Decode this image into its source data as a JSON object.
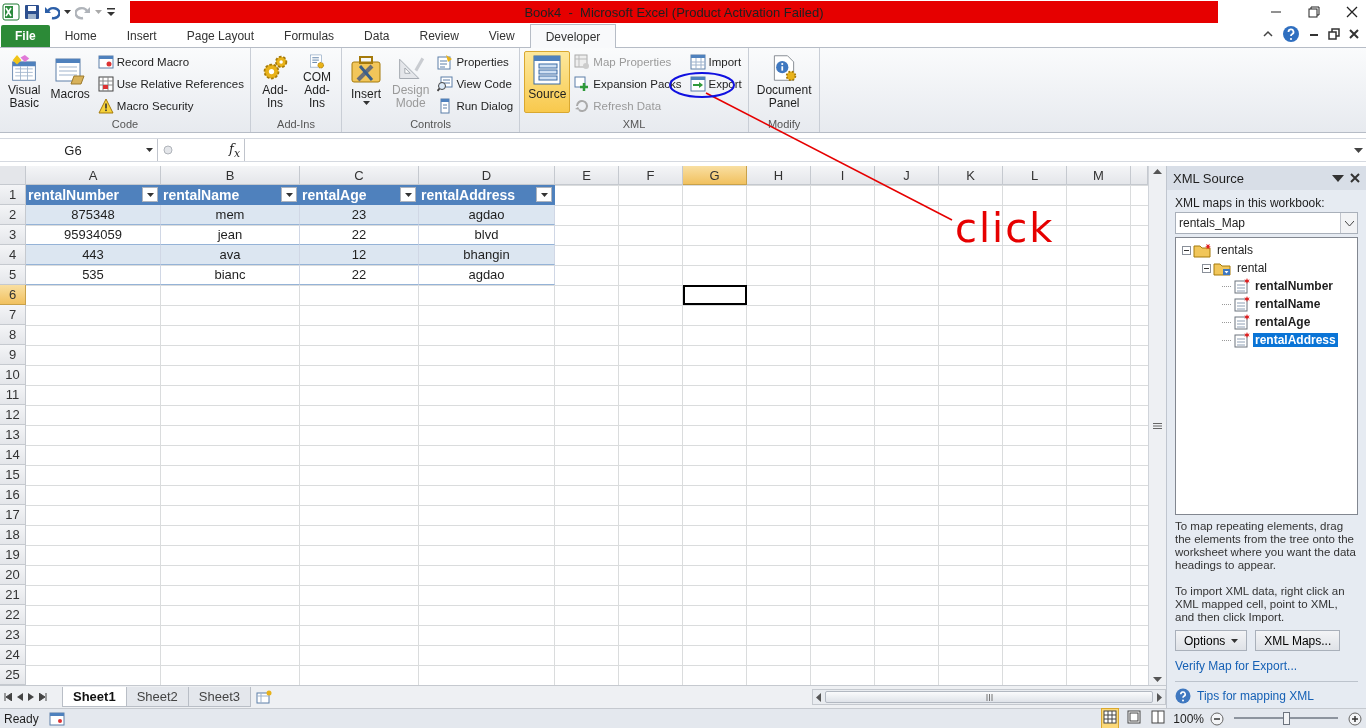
{
  "window": {
    "title": "Book4  -  Microsoft Excel (Product Activation Failed)"
  },
  "ribbon_tabs": [
    {
      "label": "File",
      "kind": "file",
      "selected": false
    },
    {
      "label": "Home",
      "kind": "tab",
      "selected": false
    },
    {
      "label": "Insert",
      "kind": "tab",
      "selected": false
    },
    {
      "label": "Page Layout",
      "kind": "tab",
      "selected": false
    },
    {
      "label": "Formulas",
      "kind": "tab",
      "selected": false
    },
    {
      "label": "Data",
      "kind": "tab",
      "selected": false
    },
    {
      "label": "Review",
      "kind": "tab",
      "selected": false
    },
    {
      "label": "View",
      "kind": "tab",
      "selected": false
    },
    {
      "label": "Developer",
      "kind": "tab",
      "selected": true
    }
  ],
  "ribbon_groups": [
    {
      "label": "Code",
      "items": [
        {
          "label": "Visual Basic",
          "kind": "large",
          "disabled": false,
          "selected": false,
          "dropdown": false
        },
        {
          "label": "Macros",
          "kind": "large",
          "disabled": false,
          "selected": false,
          "dropdown": false
        },
        {
          "label": "Record Macro",
          "kind": "small",
          "disabled": false,
          "selected": false
        },
        {
          "label": "Use Relative References",
          "kind": "small",
          "disabled": false,
          "selected": false
        },
        {
          "label": "Macro Security",
          "kind": "small",
          "disabled": false,
          "selected": false
        }
      ]
    },
    {
      "label": "Add-Ins",
      "items": [
        {
          "label": "Add-Ins",
          "kind": "large",
          "disabled": false,
          "selected": false,
          "dropdown": false
        },
        {
          "label": "COM Add-Ins",
          "kind": "large",
          "disabled": false,
          "selected": false,
          "dropdown": false
        }
      ]
    },
    {
      "label": "Controls",
      "items": [
        {
          "label": "Insert",
          "kind": "large",
          "disabled": false,
          "selected": false,
          "dropdown": true
        },
        {
          "label": "Design Mode",
          "kind": "large",
          "disabled": true,
          "selected": false,
          "dropdown": false
        },
        {
          "label": "Properties",
          "kind": "small",
          "disabled": false,
          "selected": false
        },
        {
          "label": "View Code",
          "kind": "small",
          "disabled": false,
          "selected": false
        },
        {
          "label": "Run Dialog",
          "kind": "small",
          "disabled": false,
          "selected": false
        }
      ]
    },
    {
      "label": "XML",
      "items": [
        {
          "label": "Source",
          "kind": "large",
          "disabled": false,
          "selected": true,
          "dropdown": false
        },
        {
          "label": "Map Properties",
          "kind": "small",
          "disabled": true,
          "selected": false
        },
        {
          "label": "Expansion Packs",
          "kind": "small",
          "disabled": false,
          "selected": false
        },
        {
          "label": "Refresh Data",
          "kind": "small",
          "disabled": true,
          "selected": false
        },
        {
          "label": "Import",
          "kind": "small",
          "disabled": false,
          "selected": false
        },
        {
          "label": "Export",
          "kind": "small",
          "disabled": false,
          "selected": false
        }
      ]
    },
    {
      "label": "Modify",
      "items": [
        {
          "label": "Document Panel",
          "kind": "large",
          "disabled": false,
          "selected": false,
          "dropdown": false
        }
      ]
    }
  ],
  "formula_bar": {
    "name_box": "G6",
    "function_label": "f$_{x}$"
  },
  "sheet": {
    "columns": [
      {
        "label": "A",
        "selected": false
      },
      {
        "label": "B",
        "selected": false
      },
      {
        "label": "C",
        "selected": false
      },
      {
        "label": "D",
        "selected": false
      },
      {
        "label": "E",
        "selected": false
      },
      {
        "label": "F",
        "selected": false
      },
      {
        "label": "G",
        "selected": true
      },
      {
        "label": "H",
        "selected": false
      },
      {
        "label": "I",
        "selected": false
      },
      {
        "label": "J",
        "selected": false
      },
      {
        "label": "K",
        "selected": false
      },
      {
        "label": "L",
        "selected": false
      },
      {
        "label": "M",
        "selected": false
      }
    ],
    "rows": [
      {
        "label": "1",
        "selected": false
      },
      {
        "label": "2",
        "selected": false
      },
      {
        "label": "3",
        "selected": false
      },
      {
        "label": "4",
        "selected": false
      },
      {
        "label": "5",
        "selected": false
      },
      {
        "label": "6",
        "selected": true
      },
      {
        "label": "7",
        "selected": false
      },
      {
        "label": "8",
        "selected": false
      },
      {
        "label": "9",
        "selected": false
      },
      {
        "label": "10",
        "selected": false
      },
      {
        "label": "11",
        "selected": false
      },
      {
        "label": "12",
        "selected": false
      },
      {
        "label": "13",
        "selected": false
      },
      {
        "label": "14",
        "selected": false
      },
      {
        "label": "15",
        "selected": false
      },
      {
        "label": "16",
        "selected": false
      },
      {
        "label": "17",
        "selected": false
      },
      {
        "label": "18",
        "selected": false
      },
      {
        "label": "19",
        "selected": false
      },
      {
        "label": "20",
        "selected": false
      },
      {
        "label": "21",
        "selected": false
      },
      {
        "label": "22",
        "selected": false
      },
      {
        "label": "23",
        "selected": false
      },
      {
        "label": "24",
        "selected": false
      },
      {
        "label": "25",
        "selected": false
      }
    ],
    "table": {
      "headers": [
        "rentalNumber",
        "rentalName",
        "rentalAge",
        "rentalAddress"
      ],
      "rows": [
        [
          "875348",
          "mem",
          "23",
          "agdao"
        ],
        [
          "95934059",
          "jean",
          "22",
          "blvd"
        ],
        [
          "443",
          "ava",
          "12",
          "bhangin"
        ],
        [
          "535",
          "bianc",
          "22",
          "agdao"
        ]
      ]
    }
  },
  "sheet_tabs": [
    {
      "label": "Sheet1",
      "selected": true
    },
    {
      "label": "Sheet2",
      "selected": false
    },
    {
      "label": "Sheet3",
      "selected": false
    }
  ],
  "xml_source": {
    "title": "XML Source",
    "maps_label": "XML maps in this workbook:",
    "map": "rentals_Map",
    "tree": [
      {
        "label": "rentals",
        "kind": "root",
        "expanded": true,
        "mapped": false,
        "selected": false,
        "children": [
          {
            "label": "rental",
            "kind": "repeating",
            "expanded": true,
            "mapped": false,
            "selected": false,
            "children": [
              {
                "label": "rentalNumber",
                "kind": "element",
                "mapped": true,
                "selected": false
              },
              {
                "label": "rentalName",
                "kind": "element",
                "mapped": true,
                "selected": false
              },
              {
                "label": "rentalAge",
                "kind": "element",
                "mapped": true,
                "selected": false
              },
              {
                "label": "rentalAddress",
                "kind": "element",
                "mapped": true,
                "selected": true
              }
            ]
          }
        ]
      }
    ],
    "help_texts": [
      "To map repeating elements, drag the elements from the tree onto the worksheet where you want the data headings to appear.",
      "To import XML data, right click an XML mapped cell, point to XML, and then click Import."
    ],
    "buttons": [
      {
        "label": "Options",
        "dropdown": true
      },
      {
        "label": "XML Maps...",
        "dropdown": false
      }
    ],
    "link": "Verify Map for Export...",
    "help_link": "Tips for mapping XML"
  },
  "status_bar": {
    "status": "Ready",
    "views": [
      {
        "selected": true
      },
      {
        "selected": false
      },
      {
        "selected": false
      }
    ],
    "zoom": "100%",
    "zoom_slider": {
      "level": 0.5
    }
  },
  "annotation": {
    "text": "click"
  }
}
